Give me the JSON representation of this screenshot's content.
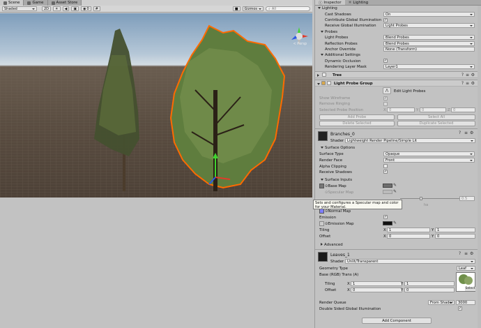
{
  "scene_tabs": [
    {
      "label": "Scene",
      "icon": "scene-icon"
    },
    {
      "label": "Game",
      "icon": "game-icon"
    },
    {
      "label": "Asset Store",
      "icon": "store-icon"
    }
  ],
  "toolbar": {
    "shading_mode": "Shaded",
    "mode_2d": "2D",
    "audio_count": "0",
    "gizmos_label": "Gizmos",
    "search_placeholder": "All"
  },
  "view": {
    "persp_label": "< Persp"
  },
  "inspector_tabs": [
    {
      "label": "Inspector",
      "icon": "info-icon"
    },
    {
      "label": "Lighting",
      "icon": "light-icon"
    }
  ],
  "lighting": {
    "section": "Lighting",
    "cast_shadows_label": "Cast Shadows",
    "cast_shadows_value": "On",
    "contribute_gi_label": "Contribute Global Illumination",
    "receive_gi_label": "Receive Global Illumination",
    "receive_gi_value": "Light Probes"
  },
  "probes": {
    "section": "Probes",
    "light_probes_label": "Light Probes",
    "light_probes_value": "Blend Probes",
    "reflection_probes_label": "Reflection Probes",
    "reflection_probes_value": "Blend Probes",
    "anchor_override_label": "Anchor Override",
    "anchor_override_value": "None (Transform)"
  },
  "additional": {
    "section": "Additional Settings",
    "dynamic_occlusion_label": "Dynamic Occlusion",
    "rendering_layer_label": "Rendering Layer Mask",
    "rendering_layer_value": "Layer1"
  },
  "tree_component": {
    "title": "Tree"
  },
  "light_probe_group": {
    "title": "Light Probe Group",
    "edit_label": "Edit Light Probes",
    "show_wireframe_label": "Show Wireframe",
    "remove_ringing_label": "Remove Ringing",
    "selected_pos_label": "Selected Probe Position",
    "x_label": "X",
    "x_value": "0",
    "y_label": "Y",
    "y_value": "0",
    "z_label": "Z",
    "z_value": "0",
    "add_probe": "Add Probe",
    "select_all": "Select All",
    "delete_selected": "Delete Selected",
    "duplicate_selected": "Duplicate Selected"
  },
  "material1": {
    "name": "Branches_0",
    "shader_label": "Shader",
    "shader_value": "Lightweight Render Pipeline/Simple Lit",
    "surface_options": "Surface Options",
    "surface_type_label": "Surface Type",
    "surface_type_value": "Opaque",
    "render_face_label": "Render Face",
    "render_face_value": "Front",
    "alpha_clipping_label": "Alpha Clipping",
    "receive_shadows_label": "Receive Shadows",
    "surface_inputs": "Surface Inputs",
    "base_map_label": "⊙Base Map",
    "specular_map_label": "⊙Specular Map",
    "smoothness_value": "0.5",
    "normal_map_label": "⊙Normal Map",
    "emission_label": "Emission",
    "emission_map_label": "⊙Emission Map",
    "tiling_label": "Tiling",
    "tiling_x": "1",
    "tiling_y": "1",
    "offset_label": "Offset",
    "offset_x": "0",
    "offset_y": "0",
    "advanced": "Advanced"
  },
  "tooltip": "Sets and configures a Specular map and color for your Material.",
  "material2": {
    "name": "Leaves_1",
    "shader_label": "Shader",
    "shader_value": "Unlit/Transparent",
    "geometry_type_label": "Geometry Type",
    "geometry_type_value": "Leaf",
    "base_label": "Base (RGB) Trans (A)",
    "tiling_label": "Tiling",
    "tiling_x": "1",
    "tiling_y": "1",
    "offset_label": "Offset",
    "offset_x": "0",
    "offset_y": "0",
    "select_label": "Select",
    "render_queue_label": "Render Queue",
    "render_queue_mode": "From Shader",
    "render_queue_value": "3000",
    "double_sided_label": "Double Sided Global Illumination"
  },
  "add_component": "Add Component",
  "colors": {
    "selection_outline": "#ff6a00",
    "leaf_green": "#6f8f4a",
    "normal_map_swatch": "#7f7fff"
  }
}
